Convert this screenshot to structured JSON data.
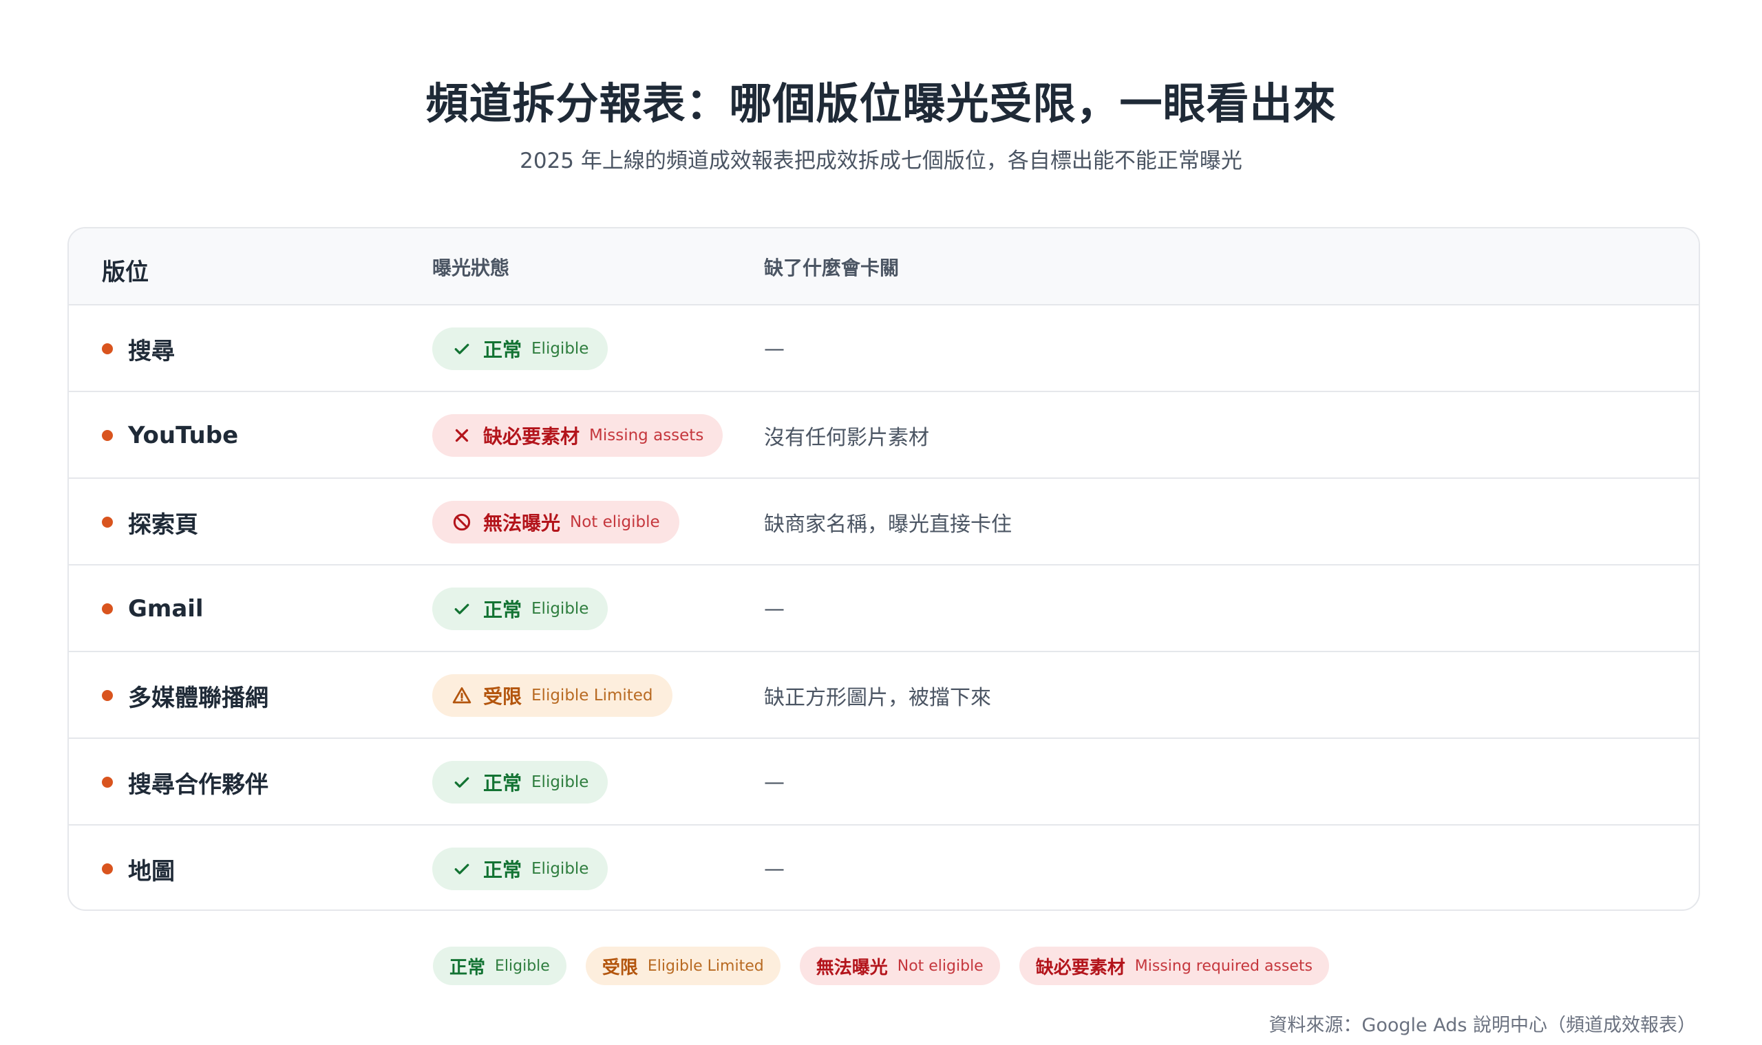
{
  "title": "頻道拆分報表：哪個版位曝光受限，一眼看出來",
  "subtitle": "2025 年上線的頻道成效報表把成效拆成七個版位，各自標出能不能正常曝光",
  "table": {
    "headers": {
      "placement": "版位",
      "status": "曝光狀態",
      "reason": "缺了什麼會卡關"
    },
    "rows": [
      {
        "placement": "搜尋",
        "status_zh": "正常",
        "status_en": "Eligible",
        "status_type": "ok",
        "icon": "check-icon",
        "reason": "—"
      },
      {
        "placement": "YouTube",
        "status_zh": "缺必要素材",
        "status_en": "Missing assets",
        "status_type": "bad",
        "icon": "x-icon",
        "reason": "沒有任何影片素材"
      },
      {
        "placement": "探索頁",
        "status_zh": "無法曝光",
        "status_en": "Not eligible",
        "status_type": "bad",
        "icon": "prohibited-icon",
        "reason": "缺商家名稱，曝光直接卡住"
      },
      {
        "placement": "Gmail",
        "status_zh": "正常",
        "status_en": "Eligible",
        "status_type": "ok",
        "icon": "check-icon",
        "reason": "—"
      },
      {
        "placement": "多媒體聯播網",
        "status_zh": "受限",
        "status_en": "Eligible Limited",
        "status_type": "limited",
        "icon": "warning-icon",
        "reason": "缺正方形圖片，被擋下來"
      },
      {
        "placement": "搜尋合作夥伴",
        "status_zh": "正常",
        "status_en": "Eligible",
        "status_type": "ok",
        "icon": "check-icon",
        "reason": "—"
      },
      {
        "placement": "地圖",
        "status_zh": "正常",
        "status_en": "Eligible",
        "status_type": "ok",
        "icon": "check-icon",
        "reason": "—"
      }
    ]
  },
  "legend": [
    {
      "zh": "正常",
      "en": "Eligible",
      "type": "ok"
    },
    {
      "zh": "受限",
      "en": "Eligible Limited",
      "type": "limited"
    },
    {
      "zh": "無法曝光",
      "en": "Not eligible",
      "type": "bad"
    },
    {
      "zh": "缺必要素材",
      "en": "Missing required assets",
      "type": "bad"
    }
  ],
  "source": "資料來源：Google Ads 說明中心（頻道成效報表）",
  "colors": {
    "accent_dot": "#d9541e",
    "ok": "#137333",
    "limited": "#b3550d",
    "bad": "#b3141b"
  }
}
